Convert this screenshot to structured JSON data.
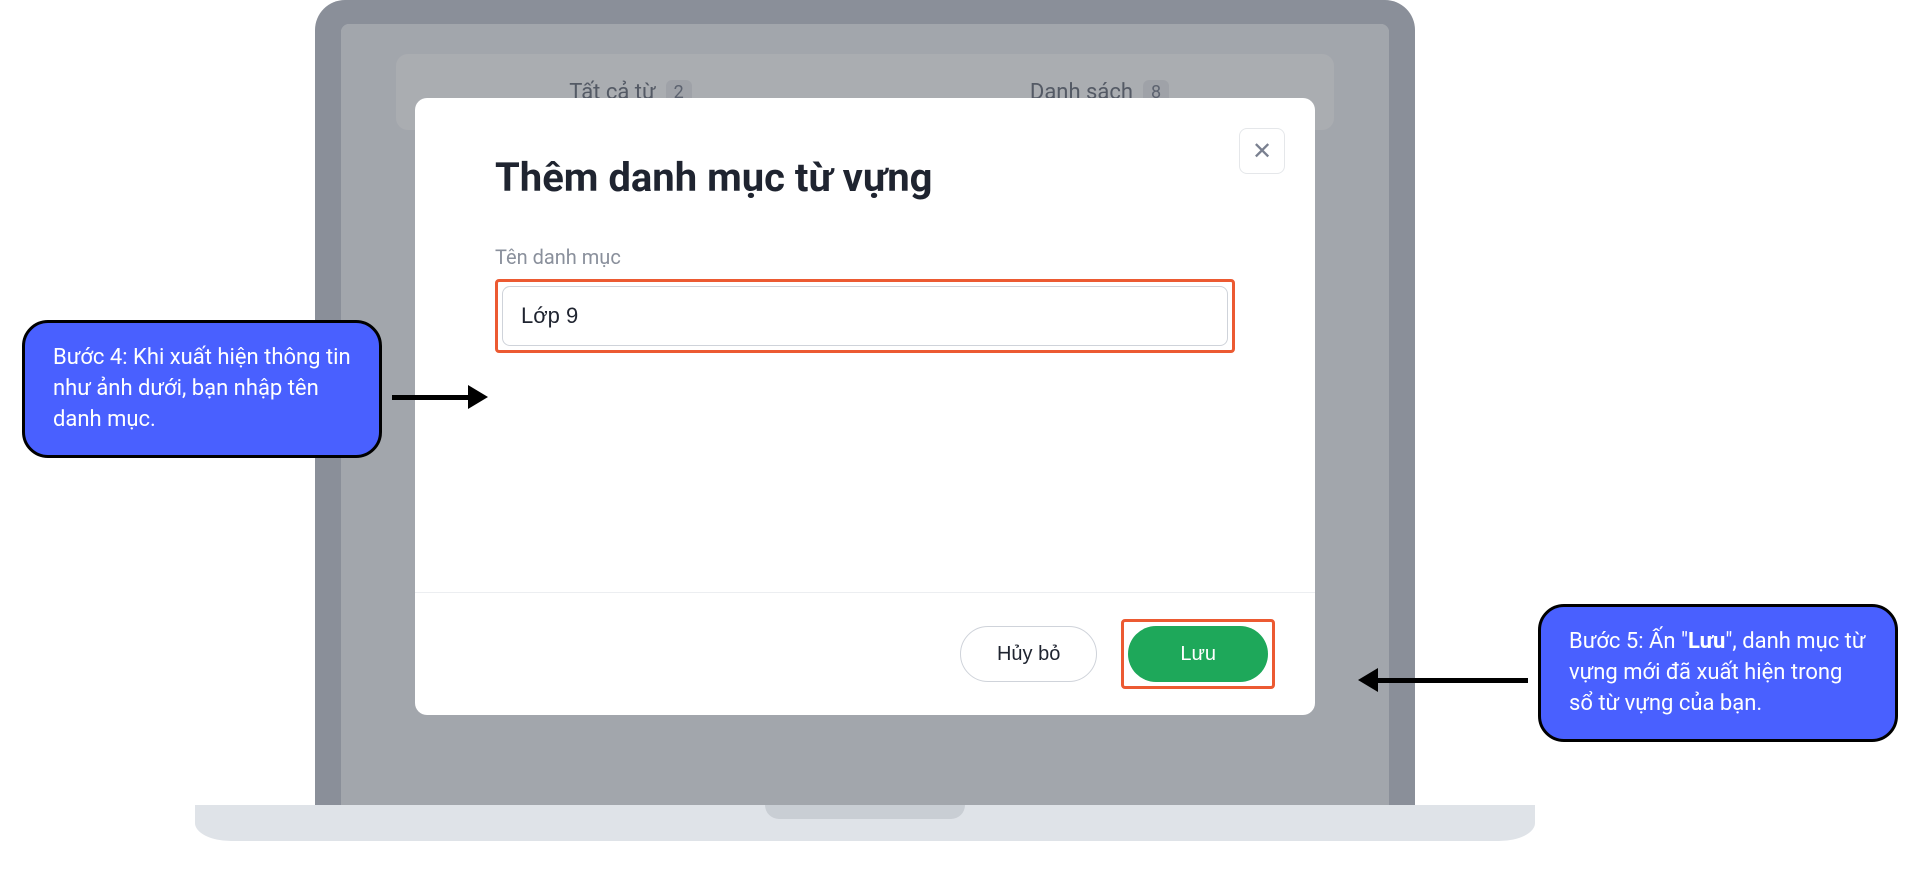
{
  "background": {
    "tab_all_words": "Tất cả từ",
    "tab_all_words_count": "2",
    "tab_list": "Danh sách",
    "tab_list_count": "8"
  },
  "modal": {
    "title": "Thêm danh mục từ vựng",
    "close_icon": "✕",
    "field_label": "Tên danh mục",
    "input_value": "Lớp 9",
    "cancel_label": "Hủy bỏ",
    "save_label": "Lưu"
  },
  "callouts": {
    "step4": "Bước 4: Khi xuất hiện thông tin như ảnh dưới, bạn nhập tên danh mục.",
    "step5_prefix": "Bước 5: Ấn \"",
    "step5_bold": "Lưu",
    "step5_suffix": "\", danh mục từ vựng mới đã xuất hiện trong sổ từ vựng của bạn."
  }
}
